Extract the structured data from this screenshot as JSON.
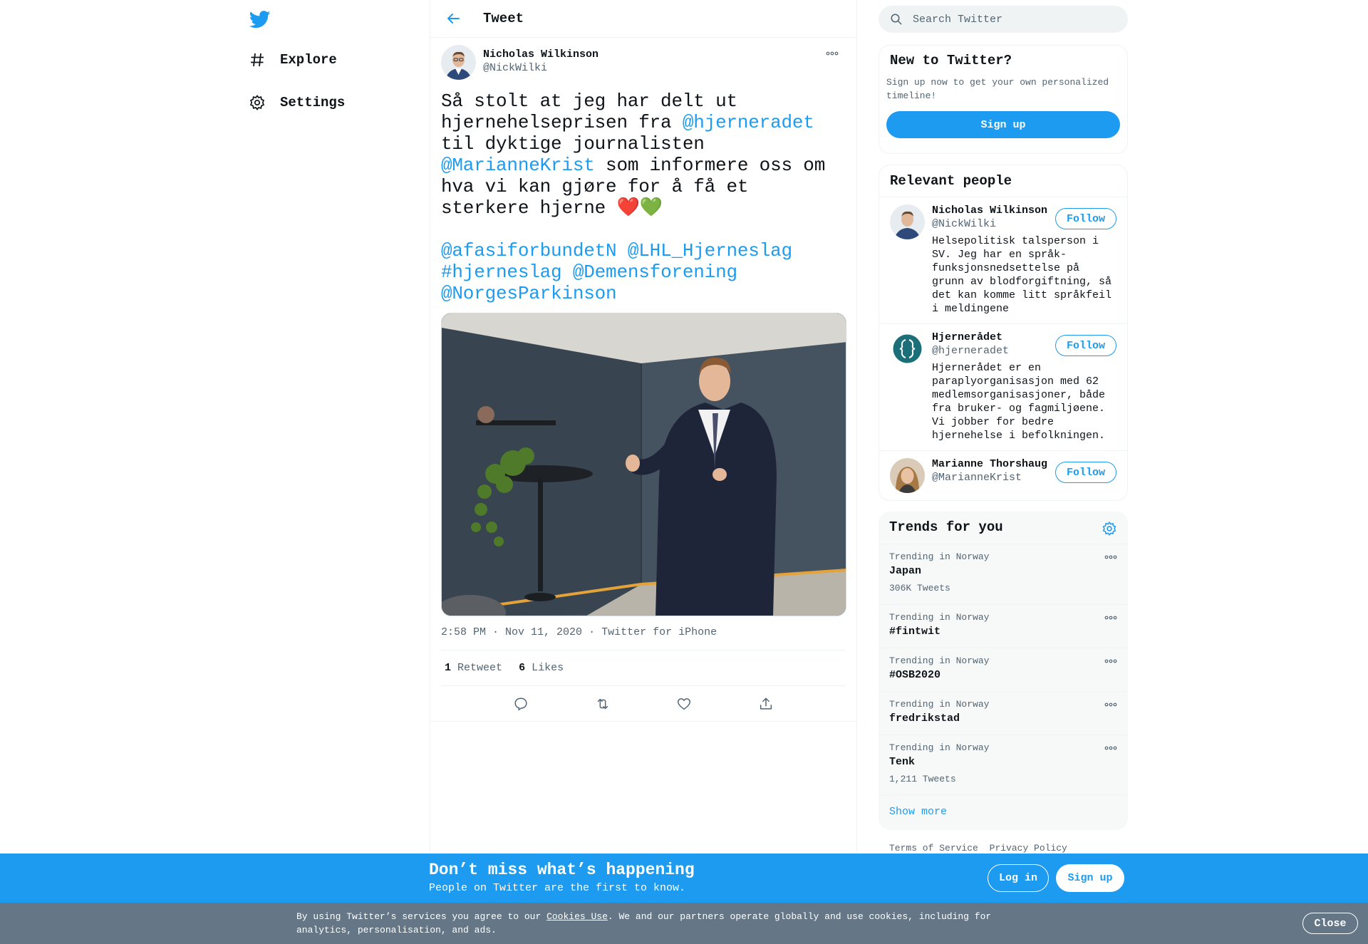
{
  "nav": {
    "explore_label": "Explore",
    "settings_label": "Settings"
  },
  "header": {
    "title": "Tweet"
  },
  "tweet": {
    "author_name": "Nicholas Wilkinson",
    "author_handle": "@NickWilki",
    "body": [
      {
        "text": "Så stolt at jeg har delt ut hjernehelseprisen fra ",
        "link": false
      },
      {
        "text": "@hjerneradet",
        "link": true
      },
      {
        "text": " til dyktige journalisten ",
        "link": false
      },
      {
        "text": "@MarianneKrist",
        "link": true
      },
      {
        "text": " som informere oss om hva vi kan gjøre for å få et sterkere hjerne ",
        "link": false
      },
      {
        "text": "❤️💚",
        "link": false
      },
      {
        "text": "\n\n",
        "link": false
      },
      {
        "text": "@afasiforbundetN",
        "link": true
      },
      {
        "text": " ",
        "link": false
      },
      {
        "text": "@LHL_Hjerneslag",
        "link": true
      },
      {
        "text": " ",
        "link": false
      },
      {
        "text": "#hjerneslag",
        "link": true
      },
      {
        "text": " ",
        "link": false
      },
      {
        "text": "@Demensforening",
        "link": true
      },
      {
        "text": " ",
        "link": false
      },
      {
        "text": "@NorgesParkinson",
        "link": true
      }
    ],
    "time": "2:58 PM · Nov 11, 2020",
    "separator": "·",
    "source": "Twitter for iPhone",
    "retweet_count": "1",
    "retweet_label": "Retweet",
    "like_count": "6",
    "like_label": "Likes"
  },
  "search": {
    "placeholder": "Search Twitter"
  },
  "new_to_twitter": {
    "title": "New to Twitter?",
    "text": "Sign up now to get your own personalized timeline!",
    "button": "Sign up"
  },
  "relevant_people": {
    "title": "Relevant people",
    "people": [
      {
        "name": "Nicholas Wilkinson",
        "handle": "@NickWilki",
        "bio": "Helsepolitisk talsperson i SV. Jeg har en språk- funksjonsnedsettelse på grunn av blodforgiftning, så det kan komme litt språkfeil i meldingene",
        "follow": "Follow"
      },
      {
        "name": "Hjernerådet",
        "handle": "@hjerneradet",
        "bio": "Hjernerådet er en paraplyorganisasjon med 62 medlemsorganisasjoner, både fra bruker- og fagmiljøene. Vi jobber for bedre hjernehelse i befolkningen.",
        "follow": "Follow"
      },
      {
        "name": "Marianne Thorshaug",
        "handle": "@MarianneKrist",
        "bio": "",
        "follow": "Follow"
      }
    ]
  },
  "trends": {
    "title": "Trends for you",
    "items": [
      {
        "context": "Trending in Norway",
        "name": "Japan",
        "count": "306K Tweets"
      },
      {
        "context": "Trending in Norway",
        "name": "#fintwit",
        "count": ""
      },
      {
        "context": "Trending in Norway",
        "name": "#OSB2020",
        "count": ""
      },
      {
        "context": "Trending in Norway",
        "name": "fredrikstad",
        "count": ""
      },
      {
        "context": "Trending in Norway",
        "name": "Tenk",
        "count": "1,211 Tweets"
      }
    ],
    "show_more": "Show more"
  },
  "footer": {
    "terms": "Terms of Service",
    "privacy": "Privacy Policy"
  },
  "signup_bar": {
    "title": "Don’t miss what’s happening",
    "subtitle": "People on Twitter are the first to know.",
    "login": "Log in",
    "signup": "Sign up"
  },
  "cookie_bar": {
    "prefix": "By using Twitter’s services you agree to our ",
    "link": "Cookies Use",
    "suffix": ". We and our partners operate globally and use cookies, including for analytics, personalisation, and ads.",
    "close": "Close"
  },
  "colors": {
    "accent": "#1d9bf0",
    "cookie_bg": "#657786",
    "text": "#0f1419",
    "muted": "#536471"
  }
}
